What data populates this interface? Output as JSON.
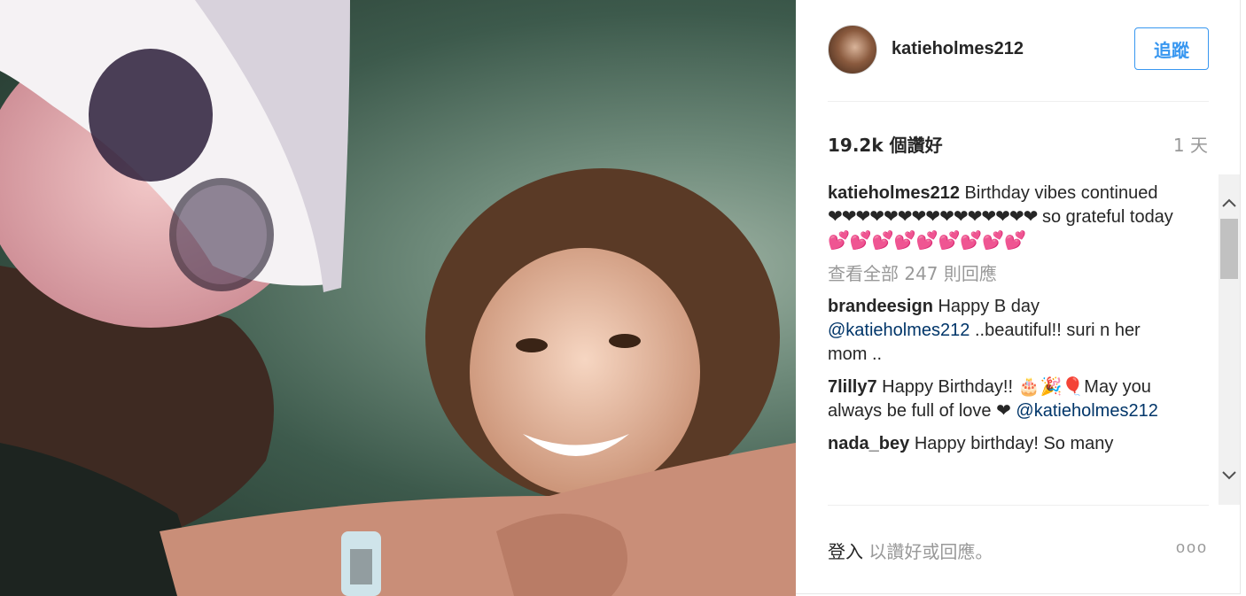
{
  "post": {
    "username": "katieholmes212",
    "follow_label": "追蹤",
    "likes": "19.2k 個讚好",
    "time": "1 天",
    "caption": {
      "user": "katieholmes212",
      "text_1": "Birthday vibes continued",
      "hearts_1": "❤❤❤❤❤❤❤❤❤❤❤❤❤❤❤",
      "text_2": "so grateful today",
      "hearts_2": "💕💕💕💕💕💕💕💕💕"
    },
    "view_all": "查看全部 247 則回應",
    "comments": [
      {
        "user": "brandeesign",
        "text": "Happy B day",
        "mention": "@katieholmes212",
        "text_after": "..beautiful!! suri n her mom .."
      },
      {
        "user": "7lilly7",
        "text": "Happy Birthday!! 🎂🎉🎈May you always be full of love ❤",
        "mention": "@katieholmes212",
        "text_after": ""
      },
      {
        "user": "nada_bey",
        "text": "Happy birthday! So many",
        "mention": "",
        "text_after": ""
      }
    ],
    "login_link": "登入",
    "login_rest": " 以讚好或回應。",
    "more_label": "ooo"
  },
  "icons": {
    "scroll_up": "chevron-up-icon",
    "scroll_down": "chevron-down-icon",
    "more": "more-options-icon"
  },
  "colors": {
    "accent": "#3897f0",
    "mention": "#003569",
    "muted": "#999999"
  }
}
